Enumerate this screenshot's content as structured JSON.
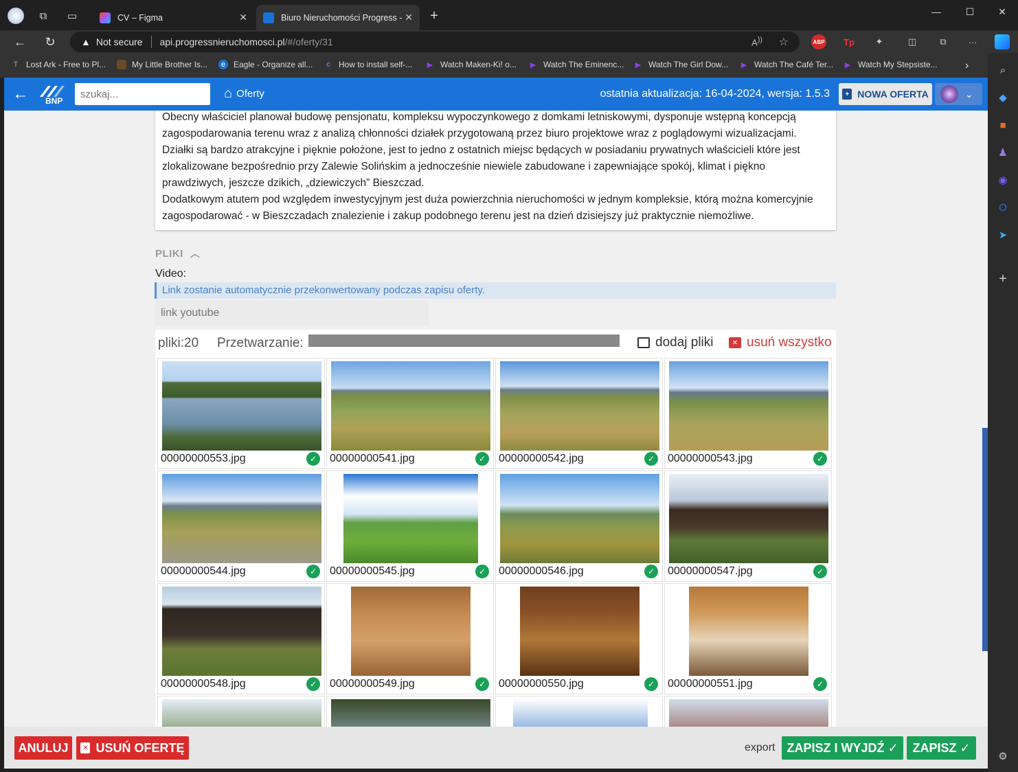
{
  "browser": {
    "tabs": [
      {
        "title": "CV – Figma",
        "favicon_color": "#a259ff"
      },
      {
        "title": "Biuro Nieruchomości Progress - ",
        "favicon_color": "#1a73d9"
      }
    ],
    "address": {
      "security": "Not secure",
      "url_host": "api.progressnieruchomosci.pl",
      "url_path": "/#/oferty/31"
    },
    "bookmarks": [
      {
        "label": "Lost Ark - Free to Pl...",
        "icon": "lost-ark-icon"
      },
      {
        "label": "My Little Brother Is...",
        "icon": "bookmark-icon"
      },
      {
        "label": "Eagle - Organize all...",
        "icon": "eagle-icon"
      },
      {
        "label": "How to install self-...",
        "icon": "c-icon"
      },
      {
        "label": "Watch Maken-Ki! o...",
        "icon": "play-icon"
      },
      {
        "label": "Watch The Eminenc...",
        "icon": "play-icon"
      },
      {
        "label": "Watch The Girl Dow...",
        "icon": "play-icon"
      },
      {
        "label": "Watch The Café Ter...",
        "icon": "play-icon"
      },
      {
        "label": "Watch My Stepsiste...",
        "icon": "play-icon"
      }
    ]
  },
  "app": {
    "search_placeholder": "szukaj...",
    "offers_link": "Oferty",
    "last_update": "ostatnia aktualizacja: 16-04-2024, wersja: 1.5.3",
    "new_offer": "NOWA OFERTA",
    "logo_text": "BNP",
    "accent_color": "#1a73d9"
  },
  "description": {
    "paragraphs": [
      "Obecny właściciel planował budowę pensjonatu, kompleksu wypoczynkowego z domkami letniskowymi, dysponuje wstępną koncepcją zagospodarowania terenu wraz z analizą chłonności działek przygotowaną przez biuro projektowe wraz z poglądowymi wizualizacjami.",
      "Działki są bardzo atrakcyjne i pięknie położone, jest to jedno z ostatnich miejsc będących w posiadaniu prywatnych właścicieli które jest zlokalizowane bezpośrednio przy Zalewie Solińskim a jednocześnie niewiele zabudowane i zapewniające spokój, klimat i piękno prawdziwych, jeszcze dzikich, „dziewiczych” Bieszczad.",
      "Dodatkowym atutem pod względem inwestycyjnym jest duża powierzchnia nieruchomości w jednym kompleksie, którą można komercyjnie zagospodarować - w Bieszczadach znalezienie i zakup podobnego terenu jest na dzień dzisiejszy już praktycznie niemożliwe."
    ]
  },
  "files": {
    "section_title": "PLIKI",
    "video_label": "Video:",
    "video_info": "Link zostanie automatycznie przekonwertowany podczas zapisu oferty.",
    "youtube_placeholder": "link youtube",
    "count_label": "pliki:20",
    "processing_label": "Przetwarzanie:",
    "add_files": "dodaj pliki",
    "delete_all": "usuń wszystko",
    "items": [
      {
        "name": "00000000553.jpg",
        "photo": "ph-lake"
      },
      {
        "name": "00000000541.jpg",
        "photo": "ph-field"
      },
      {
        "name": "00000000542.jpg",
        "photo": "ph-field2"
      },
      {
        "name": "00000000543.jpg",
        "photo": "ph-field3"
      },
      {
        "name": "00000000544.jpg",
        "photo": "ph-road"
      },
      {
        "name": "00000000545.jpg",
        "photo": "ph-cabins"
      },
      {
        "name": "00000000546.jpg",
        "photo": "ph-cabins2"
      },
      {
        "name": "00000000547.jpg",
        "photo": "ph-house"
      },
      {
        "name": "00000000548.jpg",
        "photo": "ph-house2"
      },
      {
        "name": "00000000549.jpg",
        "photo": "ph-interior"
      },
      {
        "name": "00000000550.jpg",
        "photo": "ph-interior2"
      },
      {
        "name": "00000000551.jpg",
        "photo": "ph-bath"
      },
      {
        "name": "",
        "photo": "ph-partial1"
      },
      {
        "name": "",
        "photo": "ph-partial2"
      },
      {
        "name": "",
        "photo": "ph-partial3"
      },
      {
        "name": "",
        "photo": "ph-partial4"
      }
    ]
  },
  "actions": {
    "cancel": "ANULUJ",
    "delete_offer": "USUŃ OFERTĘ",
    "export": "export",
    "save_exit": "ZAPISZ I WYJDŹ ✓",
    "save": "ZAPISZ ✓",
    "danger_color": "#d92b2b",
    "success_color": "#1aa058"
  }
}
